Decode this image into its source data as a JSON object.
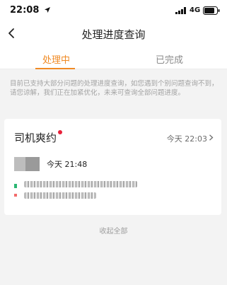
{
  "status_bar": {
    "time": "22:08",
    "network": "4G"
  },
  "nav": {
    "title": "处理进度查询"
  },
  "tabs": [
    {
      "label": "处理中",
      "active": true
    },
    {
      "label": "已完成",
      "active": false
    }
  ],
  "notice": "目前已支持大部分问题的处理进度查询，如您遇到个别问题查询不到，请您谅解，我们正在加紧优化，未来可查询全部问题进度。",
  "card": {
    "title": "司机爽约",
    "time": "今天 22:03",
    "message_time": "今天 21:48"
  },
  "footer": {
    "collapse_label": "收起全部"
  },
  "colors": {
    "accent": "#f08a24",
    "badge": "#e8213a"
  }
}
